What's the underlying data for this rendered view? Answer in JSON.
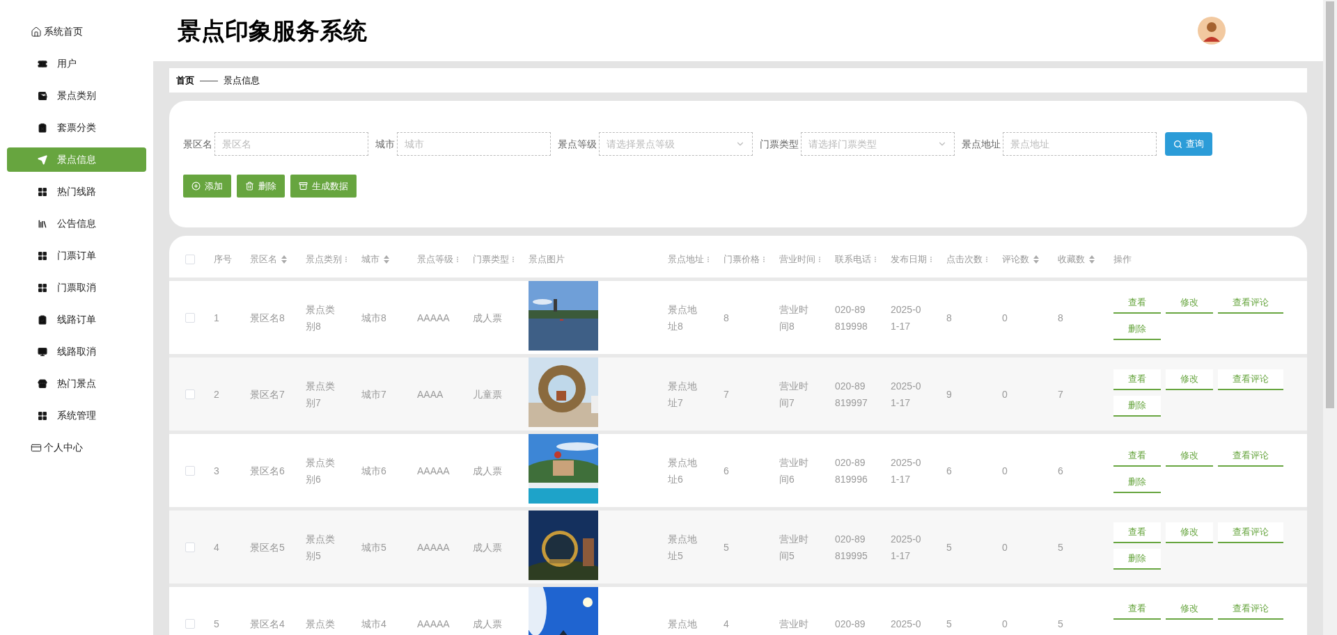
{
  "header": {
    "title": "景点印象服务系统"
  },
  "sidebar": {
    "items": [
      {
        "label": "系统首页",
        "kind": "top",
        "selected": false
      },
      {
        "label": "用户",
        "kind": "sub",
        "selected": false
      },
      {
        "label": "景点类别",
        "kind": "sub",
        "selected": false
      },
      {
        "label": "套票分类",
        "kind": "sub",
        "selected": false
      },
      {
        "label": "景点信息",
        "kind": "sub",
        "selected": true
      },
      {
        "label": "热门线路",
        "kind": "sub",
        "selected": false
      },
      {
        "label": "公告信息",
        "kind": "sub",
        "selected": false
      },
      {
        "label": "门票订单",
        "kind": "sub",
        "selected": false
      },
      {
        "label": "门票取消",
        "kind": "sub",
        "selected": false
      },
      {
        "label": "线路订单",
        "kind": "sub",
        "selected": false
      },
      {
        "label": "线路取消",
        "kind": "sub",
        "selected": false
      },
      {
        "label": "热门景点",
        "kind": "sub",
        "selected": false
      },
      {
        "label": "系统管理",
        "kind": "sub",
        "selected": false
      },
      {
        "label": "个人中心",
        "kind": "top",
        "selected": false
      }
    ]
  },
  "breadcrumb": [
    {
      "label": "首页",
      "kind": "link"
    },
    {
      "label": "——",
      "kind": "separator"
    },
    {
      "label": "景点信息",
      "kind": "current"
    }
  ],
  "filters": [
    {
      "label": "景区名",
      "kind": "text",
      "placeholder": "景区名"
    },
    {
      "label": "城市",
      "kind": "text",
      "placeholder": "城市"
    },
    {
      "label": "景点等级",
      "kind": "select",
      "placeholder": "请选择景点等级"
    },
    {
      "label": "门票类型",
      "kind": "select",
      "placeholder": "请选择门票类型"
    },
    {
      "label": "景点地址",
      "kind": "text",
      "placeholder": "景点地址"
    }
  ],
  "search_button": "查询",
  "actions": [
    {
      "label": "添加",
      "kind": "add"
    },
    {
      "label": "删除",
      "kind": "delete"
    },
    {
      "label": "生成数据",
      "kind": "generate"
    }
  ],
  "table": {
    "select_all": false,
    "columns": [
      {
        "label": "序号",
        "kind": "plain"
      },
      {
        "label": "景区名",
        "kind": "sort"
      },
      {
        "label": "景点类别",
        "kind": "resize"
      },
      {
        "label": "城市",
        "kind": "sort"
      },
      {
        "label": "景点等级",
        "kind": "resize"
      },
      {
        "label": "门票类型",
        "kind": "resize"
      },
      {
        "label": "景点图片"
      },
      {
        "label": "景点地址",
        "kind": "resize"
      },
      {
        "label": "门票价格",
        "kind": "resize"
      },
      {
        "label": "营业时间",
        "kind": "resize"
      },
      {
        "label": "联系电话",
        "kind": "resize"
      },
      {
        "label": "发布日期",
        "kind": "resize"
      },
      {
        "label": "点击次数",
        "kind": "resize"
      },
      {
        "label": "评论数",
        "kind": "sort"
      },
      {
        "label": "收藏数",
        "kind": "sort"
      },
      {
        "label": "操作",
        "kind": "actions"
      }
    ],
    "rows": [
      {
        "selected": false,
        "cells": [
          "1",
          "景区名8",
          "景点类别8",
          "城市8",
          "AAAAA",
          "成人票",
          {
            "kind": "picture"
          },
          "景点地址8",
          "8",
          "营业时间8",
          "020-89819998",
          "2025-01-17",
          "8",
          "0",
          "8"
        ],
        "actions": [
          "查看",
          "修改",
          "查看评论",
          "删除"
        ]
      },
      {
        "selected": false,
        "cells": [
          "2",
          "景区名7",
          "景点类别7",
          "城市7",
          "AAAA",
          "儿童票",
          {
            "kind": "picture"
          },
          "景点地址7",
          "7",
          "营业时间7",
          "020-89819997",
          "2025-01-17",
          "9",
          "0",
          "7"
        ],
        "actions": [
          "查看",
          "修改",
          "查看评论",
          "删除"
        ]
      },
      {
        "selected": false,
        "cells": [
          "3",
          "景区名6",
          "景点类别6",
          "城市6",
          "AAAAA",
          "成人票",
          {
            "kind": "picture"
          },
          "景点地址6",
          "6",
          "营业时间6",
          "020-89819996",
          "2025-01-17",
          "6",
          "0",
          "6"
        ],
        "actions": [
          "查看",
          "修改",
          "查看评论",
          "删除"
        ]
      },
      {
        "selected": false,
        "cells": [
          "4",
          "景区名5",
          "景点类别5",
          "城市5",
          "AAAAA",
          "成人票",
          {
            "kind": "picture"
          },
          "景点地址5",
          "5",
          "营业时间5",
          "020-89819995",
          "2025-01-17",
          "5",
          "0",
          "5"
        ],
        "actions": [
          "查看",
          "修改",
          "查看评论",
          "删除"
        ]
      },
      {
        "selected": false,
        "cells": [
          "5",
          "景区名4",
          "景点类",
          "城市4",
          "AAAAA",
          "成人票",
          {
            "kind": "picture"
          },
          "景点地",
          "4",
          "营业时",
          "020-89",
          "2025-0",
          "5",
          "0",
          "5"
        ],
        "actions": [
          "查看",
          "修改",
          "查看评论"
        ]
      }
    ]
  }
}
